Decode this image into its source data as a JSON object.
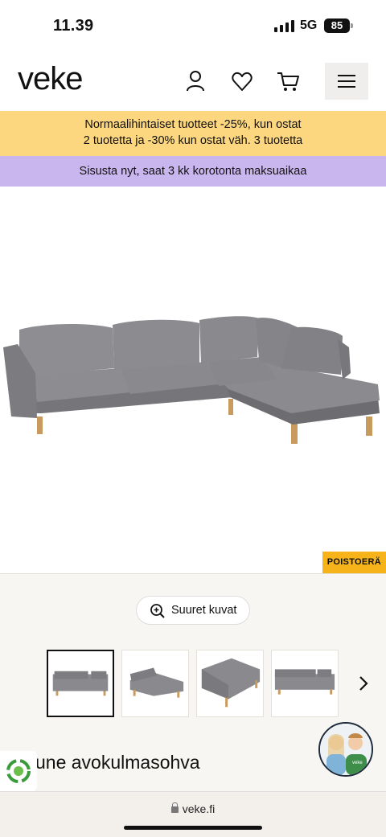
{
  "status_bar": {
    "time": "11.39",
    "network": "5G",
    "battery": "85"
  },
  "header": {
    "logo": "veke",
    "icons": [
      "user-icon",
      "heart-icon",
      "cart-icon",
      "menu-icon"
    ]
  },
  "banners": {
    "promo_line1": "Normaalihintaiset tuotteet -25%, kun ostat",
    "promo_line2": "2 tuotetta ja -30% kun ostat väh. 3 tuotetta",
    "financing": "Sisusta nyt, saat 3 kk korotonta maksuaikaa",
    "colors": {
      "promo": "#fcd77f",
      "financing": "#c9b6ee"
    }
  },
  "product": {
    "badge": "POISTOERÄ",
    "zoom_button": "Suuret kuvat",
    "title": "une avokulmasohva",
    "thumbnails": [
      "view-front",
      "view-angle",
      "view-back",
      "view-side"
    ]
  },
  "browser": {
    "url": "veke.fi"
  }
}
